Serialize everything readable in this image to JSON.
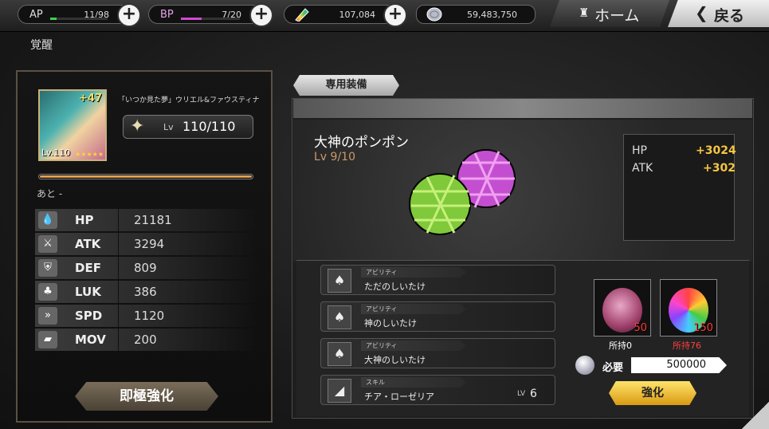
{
  "topbar": {
    "ap": {
      "label": "AP",
      "value": "11/98",
      "fill": 0.11,
      "color": "#3fd14a"
    },
    "bp": {
      "label": "BP",
      "value": "7/20",
      "fill": 0.35,
      "color": "#d14ad1"
    },
    "crystals": {
      "value": "107,084",
      "icon": "rainbow-crystal-icon"
    },
    "coins": {
      "value": "59,483,750",
      "icon": "silver-coin-icon"
    },
    "home_label": "ホーム",
    "back_label": "戻る"
  },
  "page_title": "覚醒",
  "character": {
    "plus": "+47",
    "portrait_level": "Lv.110",
    "stars": "★★★★★",
    "name": "「いつか見た夢」ウリエル&ファウスティナ",
    "level_label": "Lv",
    "level_value": "110/110",
    "exp_fill": 1.0,
    "remaining": "あと -"
  },
  "stats": [
    {
      "name": "HP",
      "value": "21181",
      "icon": "drop-icon"
    },
    {
      "name": "ATK",
      "value": "3294",
      "icon": "sword-icon"
    },
    {
      "name": "DEF",
      "value": "809",
      "icon": "shield-icon"
    },
    {
      "name": "LUK",
      "value": "386",
      "icon": "clover-icon"
    },
    {
      "name": "SPD",
      "value": "1120",
      "icon": "chevrons-icon"
    },
    {
      "name": "MOV",
      "value": "200",
      "icon": "boot-icon"
    }
  ],
  "insta_button": "即極強化",
  "equipment_tab": "専用装備",
  "equipment": {
    "name": "大神のポンポン",
    "level": "Lv 9/10",
    "bonus": [
      {
        "key": "HP",
        "value": "+3024"
      },
      {
        "key": "ATK",
        "value": "+302"
      }
    ]
  },
  "abilities": [
    {
      "tag": "アビリティ",
      "text": "ただのしいたけ",
      "icon": "mushroom-icon"
    },
    {
      "tag": "アビリティ",
      "text": "神のしいたけ",
      "icon": "mushroom-icon"
    },
    {
      "tag": "アビリティ",
      "text": "大神のしいたけ",
      "icon": "mushroom-icon"
    },
    {
      "tag": "スキル",
      "text": "チア・ローゼリア",
      "icon": "blade-icon",
      "lv_label": "LV",
      "lv_value": "6"
    }
  ],
  "materials": [
    {
      "count": "50",
      "owned": "所持0",
      "owned_color": "#ffffff"
    },
    {
      "count": "150",
      "owned": "所持76",
      "owned_color": "#ff4040"
    }
  ],
  "required": {
    "label": "必要",
    "value": "500000"
  },
  "enhance_button": "強化"
}
